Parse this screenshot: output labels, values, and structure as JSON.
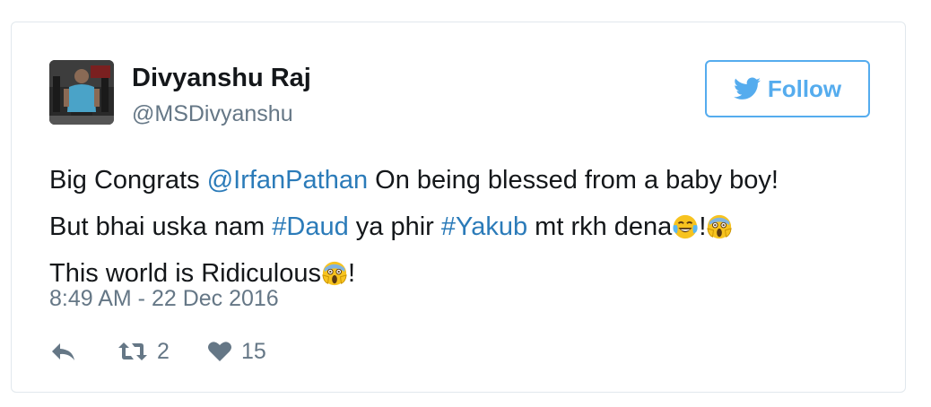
{
  "user": {
    "name": "Divyanshu Raj",
    "handle": "@MSDivyanshu"
  },
  "follow_button": {
    "label": "Follow",
    "icon": "twitter-bird-icon"
  },
  "tweet": {
    "line1_before": "Big Congrats ",
    "mention": "@IrfanPathan",
    "line1_after": " On being blessed from a baby boy!",
    "line2_before": "But bhai uska nam ",
    "hashtag1": "#Daud",
    "line2_middle": " ya phir ",
    "hashtag2": "#Yakub",
    "line2_after": " mt rkh dena",
    "line2_bang": "!",
    "line3_before": "This world is Ridiculous",
    "line3_bang": "!"
  },
  "timestamp": "8:49 AM - 22 Dec 2016",
  "actions": {
    "reply_icon": "reply-icon",
    "retweet_icon": "retweet-icon",
    "retweet_count": "2",
    "like_icon": "heart-icon",
    "like_count": "15"
  },
  "colors": {
    "link": "#2b7bb9",
    "accent": "#55acee",
    "text": "#14171a",
    "muted": "#657786",
    "border": "#e1e8ed"
  }
}
